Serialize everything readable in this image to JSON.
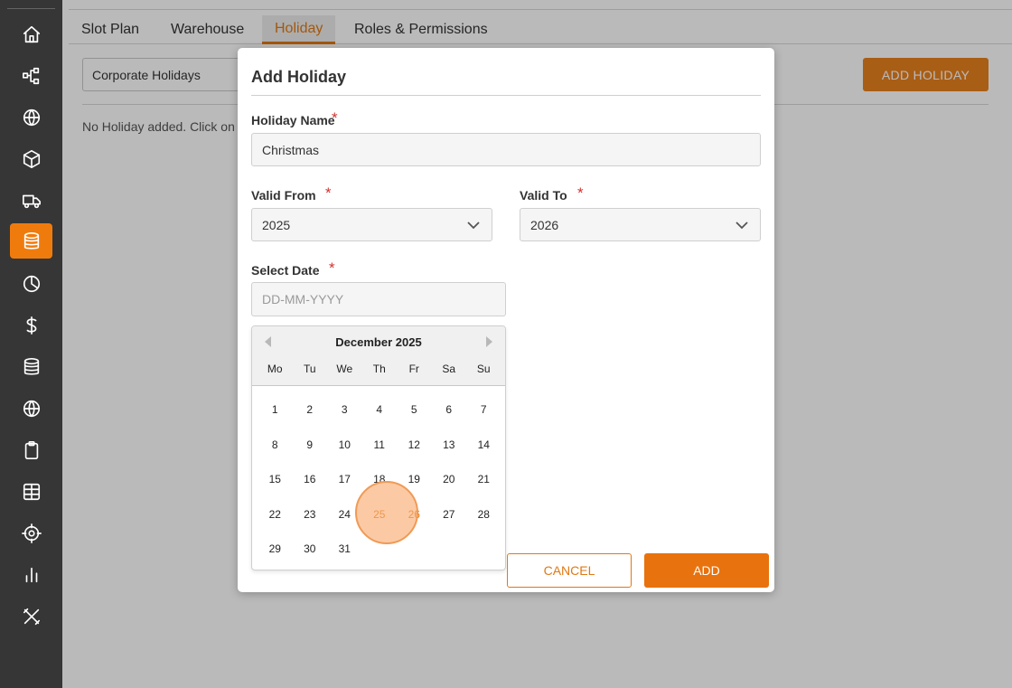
{
  "sidebar": {
    "items": [
      {
        "icon": "home-icon"
      },
      {
        "icon": "flow-icon"
      },
      {
        "icon": "globe-icon"
      },
      {
        "icon": "box-icon"
      },
      {
        "icon": "truck-icon"
      },
      {
        "icon": "database-icon",
        "active": true
      },
      {
        "icon": "pie-chart-icon"
      },
      {
        "icon": "dollar-icon"
      },
      {
        "icon": "stack-icon"
      },
      {
        "icon": "globe-icon"
      },
      {
        "icon": "clipboard-icon"
      },
      {
        "icon": "grid-icon"
      },
      {
        "icon": "target-icon"
      },
      {
        "icon": "bar-chart-icon"
      },
      {
        "icon": "tools-icon"
      }
    ],
    "active_color": "#f07b0d"
  },
  "tabs": [
    "Slot Plan",
    "Warehouse",
    "Holiday",
    "Roles & Permissions"
  ],
  "active_tab": "Holiday",
  "main": {
    "holiday_type_select": "Corporate Holidays",
    "add_holiday_label": "ADD HOLIDAY",
    "empty_text": "No Holiday added. Click on A"
  },
  "modal": {
    "title": "Add Holiday",
    "holiday_name_label": "Holiday Name",
    "holiday_name_value": "Christmas",
    "valid_from_label": "Valid From",
    "valid_from_value": "2025",
    "valid_to_label": "Valid To",
    "valid_to_value": "2026",
    "select_date_label": "Select Date",
    "date_placeholder": "DD-MM-YYYY",
    "required_mark": "*",
    "cancel_label": "CANCEL",
    "add_label": "ADD"
  },
  "calendar": {
    "month_label": "December 2025",
    "weekdays": [
      "Mo",
      "Tu",
      "We",
      "Th",
      "Fr",
      "Sa",
      "Su"
    ],
    "weeks": [
      [
        "1",
        "2",
        "3",
        "4",
        "5",
        "6",
        "7"
      ],
      [
        "8",
        "9",
        "10",
        "11",
        "12",
        "13",
        "14"
      ],
      [
        "15",
        "16",
        "17",
        "18",
        "19",
        "20",
        "21"
      ],
      [
        "22",
        "23",
        "24",
        "25",
        "26",
        "27",
        "28"
      ],
      [
        "29",
        "30",
        "31",
        "",
        "",
        "",
        ""
      ]
    ],
    "highlighted_days": [
      "25",
      "26"
    ]
  },
  "colors": {
    "accent": "#e07914",
    "sidebar_bg": "#4b4b4b",
    "overlay": "rgba(0,0,0,0.27)"
  }
}
